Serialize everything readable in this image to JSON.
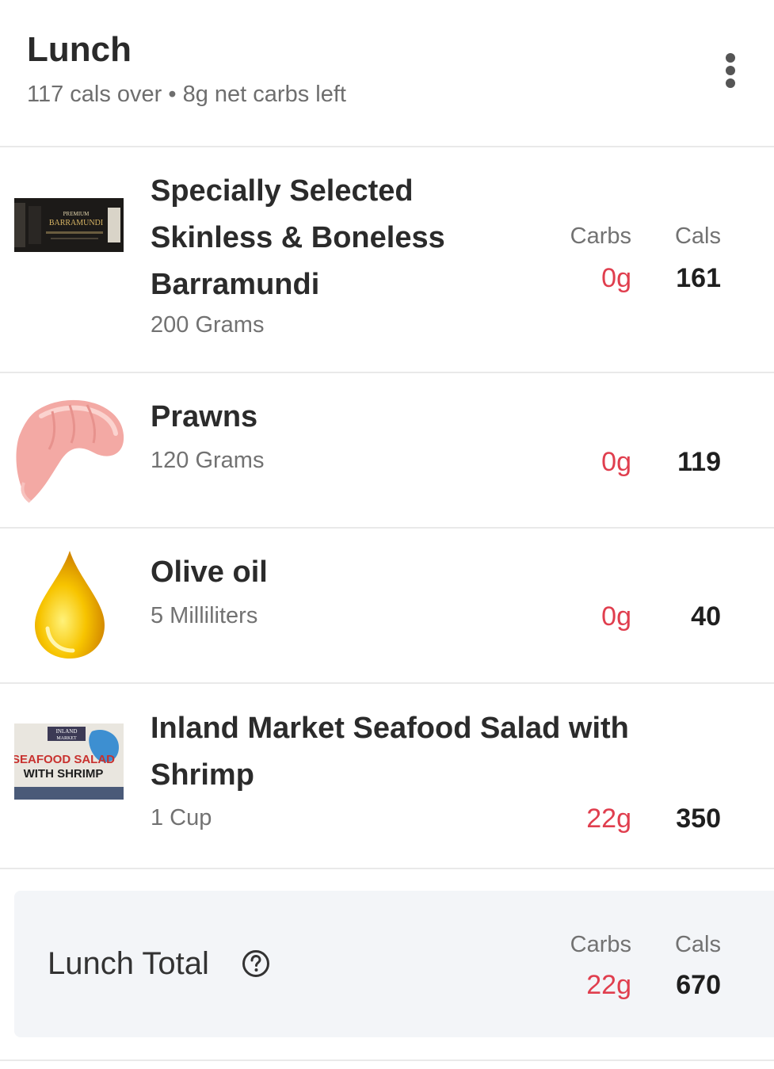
{
  "header": {
    "title": "Lunch",
    "summary": "117 cals over • 8g net carbs left"
  },
  "columns": {
    "carbs_label": "Carbs",
    "cals_label": "Cals"
  },
  "items": [
    {
      "name_lines": [
        "Specially Selected",
        "Skinless & Boneless",
        "Barramundi"
      ],
      "serving": "200 Grams",
      "carbs": "0g",
      "cals": "161",
      "thumb_text": [
        "PREMIUM",
        "BARRAMUNDI"
      ]
    },
    {
      "name_lines": [
        "Prawns"
      ],
      "serving": "120 Grams",
      "carbs": "0g",
      "cals": "119"
    },
    {
      "name_lines": [
        "Olive oil"
      ],
      "serving": "5 Milliliters",
      "carbs": "0g",
      "cals": "40"
    },
    {
      "name_lines": [
        "Inland Market Seafood Salad with",
        "Shrimp"
      ],
      "serving": "1 Cup",
      "carbs": "22g",
      "cals": "350",
      "thumb_text": [
        "INLAND",
        "MARKET",
        "SEAFOOD SALAD",
        "WITH SHRIMP"
      ]
    }
  ],
  "total": {
    "label": "Lunch Total",
    "carbs": "22g",
    "cals": "670"
  },
  "colors": {
    "carbs_red": "#e03e4e",
    "card_bg": "#f3f5f8"
  }
}
